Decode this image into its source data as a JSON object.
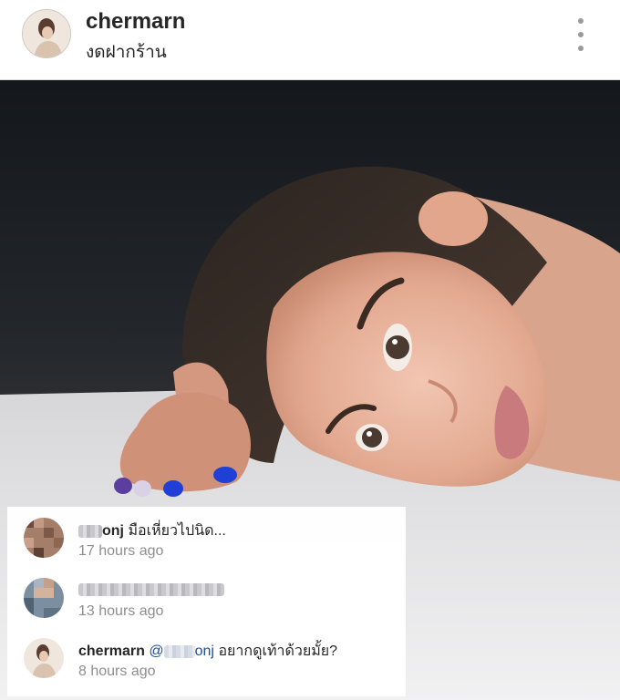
{
  "header": {
    "username": "chermarn",
    "location": "งดฝากร้าน"
  },
  "photo": {
    "alt": ""
  },
  "comments": [
    {
      "username": "onj",
      "text": "มือเหี่ยวไปนิด...",
      "time": "17 hours ago"
    },
    {
      "username": "",
      "text": "",
      "time": "13 hours ago"
    },
    {
      "username": "chermarn",
      "mention": "@",
      "mention_suffix": "onj",
      "text": "อยากดูเท้าด้วยมั้ย?",
      "time": "8 hours ago"
    }
  ],
  "colors": {
    "mention": "#1d4ea0",
    "timestamp": "#8e8e8e",
    "text": "#262626",
    "nail_polish": "#1f3fd6"
  },
  "icons": {
    "more": "vertical-ellipsis-icon"
  }
}
